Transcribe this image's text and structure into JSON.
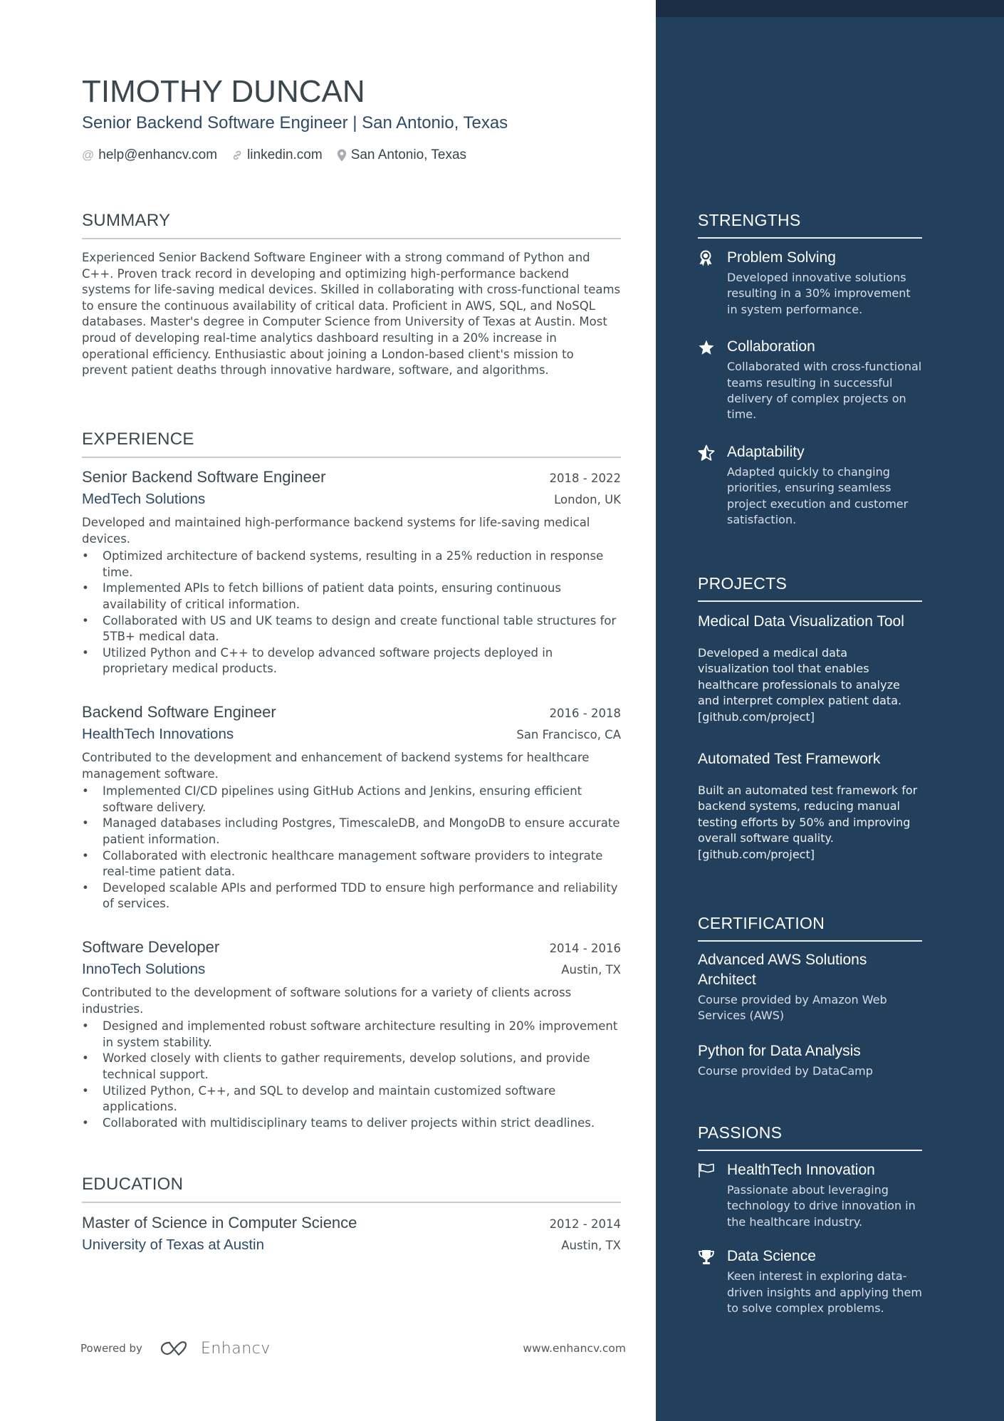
{
  "header": {
    "name": "TIMOTHY DUNCAN",
    "subtitle": "Senior Backend Software Engineer | San Antonio, Texas",
    "contacts": [
      {
        "icon": "at-icon",
        "text": "help@enhancv.com"
      },
      {
        "icon": "link-icon",
        "text": "linkedin.com"
      },
      {
        "icon": "location-pin-icon",
        "text": "San Antonio, Texas"
      }
    ]
  },
  "summary": {
    "title": "SUMMARY",
    "text": "Experienced Senior Backend Software Engineer with a strong command of Python and C++. Proven track record in developing and optimizing high-performance backend systems for life-saving medical devices. Skilled in collaborating with cross-functional teams to ensure the continuous availability of critical data. Proficient in AWS, SQL, and NoSQL databases. Master's degree in Computer Science from University of Texas at Austin. Most proud of developing real-time analytics dashboard resulting in a 20% increase in operational efficiency. Enthusiastic about joining a London-based client's mission to prevent patient deaths through innovative hardware, software, and algorithms."
  },
  "experience": {
    "title": "EXPERIENCE",
    "jobs": [
      {
        "title": "Senior Backend Software Engineer",
        "dates": "2018 - 2022",
        "company": "MedTech Solutions",
        "location": "London, UK",
        "description": "Developed and maintained high-performance backend systems for life-saving medical devices.",
        "bullets": [
          "Optimized architecture of backend systems, resulting in a 25% reduction in response time.",
          "Implemented APIs to fetch billions of patient data points, ensuring continuous availability of critical information.",
          "Collaborated with US and UK teams to design and create functional table structures for 5TB+ medical data.",
          "Utilized Python and C++ to develop advanced software projects deployed in proprietary medical products."
        ]
      },
      {
        "title": "Backend Software Engineer",
        "dates": "2016 - 2018",
        "company": "HealthTech Innovations",
        "location": "San Francisco, CA",
        "description": "Contributed to the development and enhancement of backend systems for healthcare management software.",
        "bullets": [
          "Implemented CI/CD pipelines using GitHub Actions and Jenkins, ensuring efficient software delivery.",
          "Managed databases including Postgres, TimescaleDB, and MongoDB to ensure accurate patient information.",
          "Collaborated with electronic healthcare management software providers to integrate real-time patient data.",
          "Developed scalable APIs and performed TDD to ensure high performance and reliability of services."
        ]
      },
      {
        "title": "Software Developer",
        "dates": "2014 - 2016",
        "company": "InnoTech Solutions",
        "location": "Austin, TX",
        "description": "Contributed to the development of software solutions for a variety of clients across industries.",
        "bullets": [
          "Designed and implemented robust software architecture resulting in 20% improvement in system stability.",
          "Worked closely with clients to gather requirements, develop solutions, and provide technical support.",
          "Utilized Python, C++, and SQL to develop and maintain customized software applications.",
          "Collaborated with multidisciplinary teams to deliver projects within strict deadlines."
        ]
      }
    ]
  },
  "education": {
    "title": "EDUCATION",
    "items": [
      {
        "degree": "Master of Science in Computer Science",
        "dates": "2012 - 2014",
        "school": "University of Texas at Austin",
        "location": "Austin, TX"
      }
    ]
  },
  "footer": {
    "powered_by": "Powered by",
    "brand": "Enhancv",
    "website": "www.enhancv.com"
  },
  "sidebar": {
    "strengths": {
      "title": "STRENGTHS",
      "items": [
        {
          "icon": "award-ribbon-icon",
          "title": "Problem Solving",
          "description": "Developed innovative solutions resulting in a 30% improvement in system performance."
        },
        {
          "icon": "star-icon",
          "title": "Collaboration",
          "description": "Collaborated with cross-functional teams resulting in successful delivery of complex projects on time."
        },
        {
          "icon": "half-star-icon",
          "title": "Adaptability",
          "description": "Adapted quickly to changing priorities, ensuring seamless project execution and customer satisfaction."
        }
      ]
    },
    "projects": {
      "title": "PROJECTS",
      "items": [
        {
          "title": "Medical Data Visualization Tool",
          "description": "Developed a medical data visualization tool that enables healthcare professionals to analyze and interpret complex patient data. [github.com/project]"
        },
        {
          "title": "Automated Test Framework",
          "description": "Built an automated test framework for backend systems, reducing manual testing efforts by 50% and improving overall software quality. [github.com/project]"
        }
      ]
    },
    "certification": {
      "title": "CERTIFICATION",
      "items": [
        {
          "title": "Advanced AWS Solutions Architect",
          "description": "Course provided by Amazon Web Services (AWS)"
        },
        {
          "title": "Python for Data Analysis",
          "description": "Course provided by DataCamp"
        }
      ]
    },
    "passions": {
      "title": "PASSIONS",
      "items": [
        {
          "icon": "flag-icon",
          "title": "HealthTech Innovation",
          "description": "Passionate about leveraging technology to drive innovation in the healthcare industry."
        },
        {
          "icon": "trophy-icon",
          "title": "Data Science",
          "description": "Keen interest in exploring data-driven insights and applying them to solve complex problems."
        }
      ]
    }
  },
  "colors": {
    "sidebar_bg": "#223f5c",
    "sidebar_top_band": "#1a2d44",
    "accent_blue": "#2e4a66",
    "heading_text": "#3a474f",
    "body_text": "#464e54",
    "rule": "#c8cbce"
  }
}
